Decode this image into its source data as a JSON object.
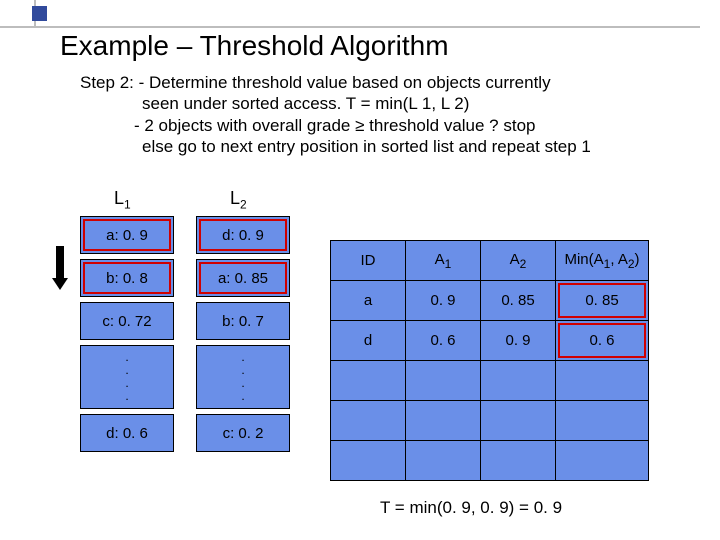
{
  "title": "Example – Threshold Algorithm",
  "step": {
    "lead": "Step 2: - Determine threshold value based on objects currently",
    "l2": "seen under sorted access.    T =  min(L 1, L 2)",
    "l3": "- 2 objects with overall grade ≥ threshold value ? stop",
    "l4": "else go to next entry position in sorted list and repeat step 1"
  },
  "labels": {
    "L1": "L",
    "L1sub": "1",
    "L2": "L",
    "L2sub": "2"
  },
  "L1": [
    "a: 0. 9",
    "b: 0. 8",
    "c: 0. 72",
    "d: 0. 6"
  ],
  "L2": [
    "d: 0. 9",
    "a: 0. 85",
    "b: 0. 7",
    "c: 0. 2"
  ],
  "dots": [
    ".",
    ".",
    ".",
    "."
  ],
  "result": {
    "headers": [
      "ID",
      "A1",
      "A2",
      "Min(A1, A2)"
    ],
    "rows": [
      {
        "id": "a",
        "a1": "0. 9",
        "a2": "0. 85",
        "min": "0. 85"
      },
      {
        "id": "d",
        "a1": "0. 6",
        "a2": "0. 9",
        "min": "0. 6"
      }
    ]
  },
  "footer": "T = min(0. 9, 0. 9) = 0. 9",
  "chart_data": {
    "type": "table",
    "title": "Threshold Algorithm Step 2",
    "lists": {
      "L1": [
        {
          "obj": "a",
          "val": 0.9
        },
        {
          "obj": "b",
          "val": 0.8
        },
        {
          "obj": "c",
          "val": 0.72
        },
        {
          "obj": "d",
          "val": 0.6
        }
      ],
      "L2": [
        {
          "obj": "d",
          "val": 0.9
        },
        {
          "obj": "a",
          "val": 0.85
        },
        {
          "obj": "b",
          "val": 0.7
        },
        {
          "obj": "c",
          "val": 0.2
        }
      ]
    },
    "seen": [
      {
        "ID": "a",
        "A1": 0.9,
        "A2": 0.85,
        "min": 0.85
      },
      {
        "ID": "d",
        "A1": 0.6,
        "A2": 0.9,
        "min": 0.6
      }
    ],
    "threshold": 0.9
  }
}
